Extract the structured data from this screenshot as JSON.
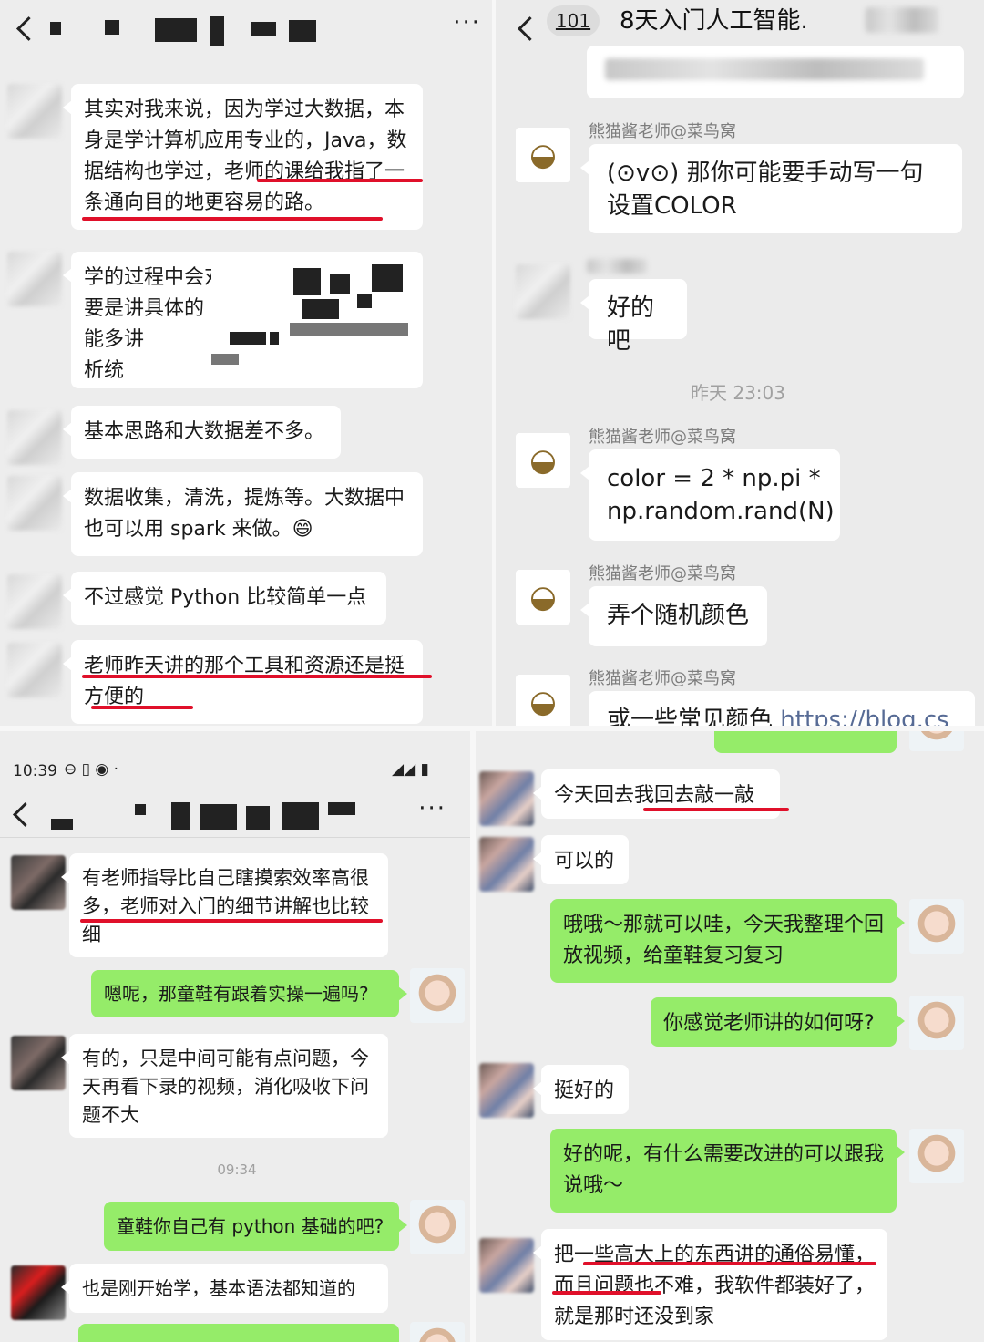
{
  "panel1": {
    "messages": [
      "其实对我来说，因为学过大数据，本身是学计算机应用专业的，Java，数据结构也学过，老师的课给我指了一条通向目的地更容易的路。",
      "学的过程中会对比，",
      "要是讲具体的",
      "能多讲",
      "析统",
      "基本思路和大数据差不多。",
      "数据收集，清洗，提炼等。大数据中也可以用 spark 来做。😄",
      "不过感觉 Python 比较简单一点",
      "老师昨天讲的那个工具和资源还是挺方便的"
    ],
    "more_icon": "···"
  },
  "panel2": {
    "header": {
      "badge": "101",
      "title": "8天入门人工智能."
    },
    "sender": "熊猫酱老师@菜鸟窝",
    "messages": [
      "(⊙v⊙) 那你可能要手动写一句设置COLOR",
      "好的吧",
      "color = 2 * np.pi * np.random.rand(N)",
      "弄个随机颜色",
      "或一些常见颜色 "
    ],
    "link": "https://blog.cs",
    "timestamp": "昨天 23:03"
  },
  "panel3": {
    "status_time": "10:39",
    "more_icon": "···",
    "messages": [
      "有老师指导比自己瞎摸索效率高很多，老师对入门的细节讲解也比较细",
      "嗯呢，那童鞋有跟着实操一遍吗?",
      "有的，只是中间可能有点问题，今天再看下录的视频，消化吸收下问题不大",
      "童鞋你自己有 python 基础的吧?",
      "也是刚开始学，基本语法都知道的"
    ],
    "timestamp": "09:34"
  },
  "panel4": {
    "messages": [
      "今天回去我回去敲一敲",
      "可以的",
      "哦哦～那就可以哇，今天我整理个回放视频，给童鞋复习复习",
      "你感觉老师讲的如何呀?",
      "挺好的",
      "好的呢，有什么需要改进的可以跟我说哦～",
      "把一些高大上的东西讲的通俗易懂，而且问题也不难，我软件都装好了，就是那时还没到家"
    ]
  }
}
